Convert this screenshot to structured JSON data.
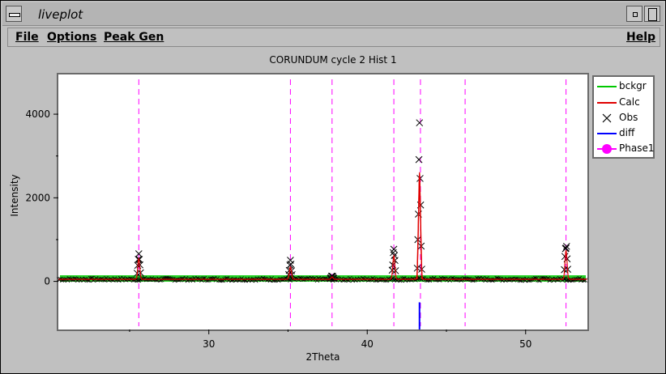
{
  "window": {
    "title": "liveplot"
  },
  "menu": {
    "file": "File",
    "options": "Options",
    "peak_gen": "Peak Gen",
    "help": "Help"
  },
  "plot": {
    "title": "CORUNDUM cycle 2 Hist 1"
  },
  "legend": [
    {
      "label": "bckgr",
      "color": "#00c800",
      "style": "line"
    },
    {
      "label": "Calc",
      "color": "#e00000",
      "style": "line"
    },
    {
      "label": "Obs",
      "color": "#000000",
      "style": "cross"
    },
    {
      "label": "diff",
      "color": "#0000ff",
      "style": "line"
    },
    {
      "label": "Phase1",
      "color": "#ff00ff",
      "style": "dot"
    }
  ],
  "chart_data": {
    "type": "line",
    "title": "CORUNDUM cycle 2 Hist 1",
    "xlabel": "2Theta",
    "ylabel": "Intensity",
    "xlim": [
      20.5,
      53.9
    ],
    "ylim": [
      -1150,
      4950
    ],
    "x_ticks": [
      30,
      40,
      50
    ],
    "y_ticks": [
      0,
      2000,
      4000
    ],
    "x_tick_labels": [
      "30",
      "40",
      "50"
    ],
    "y_tick_labels": [
      "0",
      "2000",
      "4000"
    ],
    "background_level": 50,
    "phase1_reflections": [
      25.58,
      35.15,
      37.78,
      41.68,
      43.36,
      46.18,
      52.55
    ],
    "peaks": [
      {
        "x": 25.58,
        "height": 750
      },
      {
        "x": 35.15,
        "height": 450
      },
      {
        "x": 37.78,
        "height": 90
      },
      {
        "x": 41.68,
        "height": 850
      },
      {
        "x": 43.3,
        "height": 3880
      },
      {
        "x": 52.55,
        "height": 1050
      }
    ],
    "calc_peak": {
      "x": 43.3,
      "height": 2550
    },
    "diff_min": {
      "x": 43.3,
      "value": -1150
    },
    "series": [
      {
        "name": "bckgr",
        "color": "#00c800"
      },
      {
        "name": "Calc",
        "color": "#e00000"
      },
      {
        "name": "Obs",
        "color": "#000000"
      },
      {
        "name": "diff",
        "color": "#0000ff"
      },
      {
        "name": "Phase1",
        "color": "#ff00ff"
      }
    ]
  }
}
